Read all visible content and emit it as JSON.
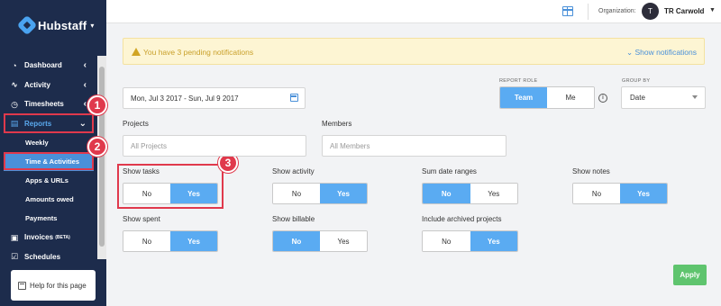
{
  "app": {
    "name": "Hubstaff"
  },
  "sidebar": {
    "nav": {
      "dashboard": "Dashboard",
      "activity": "Activity",
      "timesheets": "Timesheets",
      "reports": "Reports",
      "invoices": "Invoices",
      "invoices_sup": "(BETA)",
      "schedules": "Schedules"
    },
    "reports_sub": {
      "weekly": "Weekly",
      "time_activities": "Time & Activities",
      "apps_urls": "Apps & URLs",
      "amounts_owed": "Amounts owed",
      "payments": "Payments"
    },
    "help": "Help for this page"
  },
  "annotations": [
    "1",
    "2",
    "3"
  ],
  "topbar": {
    "org_label": "Organization:",
    "avatar_initial": "T",
    "org_name": "TR Carwold"
  },
  "notification": {
    "text": "You have 3 pending notifications",
    "link": "Show notifications"
  },
  "filters": {
    "date_range": "Mon, Jul 3 2017 - Sun, Jul 9 2017",
    "report_role_label": "REPORT ROLE",
    "report_role_options": [
      "Team",
      "Me"
    ],
    "report_role_selected": "Team",
    "group_by_label": "GROUP BY",
    "group_by_value": "Date",
    "projects_label": "Projects",
    "projects_placeholder": "All Projects",
    "members_label": "Members",
    "members_placeholder": "All Members"
  },
  "toggles": {
    "no": "No",
    "yes": "Yes",
    "show_tasks": {
      "label": "Show tasks",
      "value": "Yes"
    },
    "show_activity": {
      "label": "Show activity",
      "value": "Yes"
    },
    "sum_date_ranges": {
      "label": "Sum date ranges",
      "value": "No"
    },
    "show_notes": {
      "label": "Show notes",
      "value": "Yes"
    },
    "show_spent": {
      "label": "Show spent",
      "value": "Yes"
    },
    "show_billable": {
      "label": "Show billable",
      "value": "No"
    },
    "include_archived": {
      "label": "Include archived projects",
      "value": "Yes"
    }
  },
  "apply_label": "Apply",
  "colors": {
    "sidebar_bg": "#1d2c4c",
    "accent_blue": "#5aabf2",
    "annotation_red": "#e0394c",
    "apply_green": "#5fc46e",
    "notice_bg": "#fdf5d3"
  }
}
